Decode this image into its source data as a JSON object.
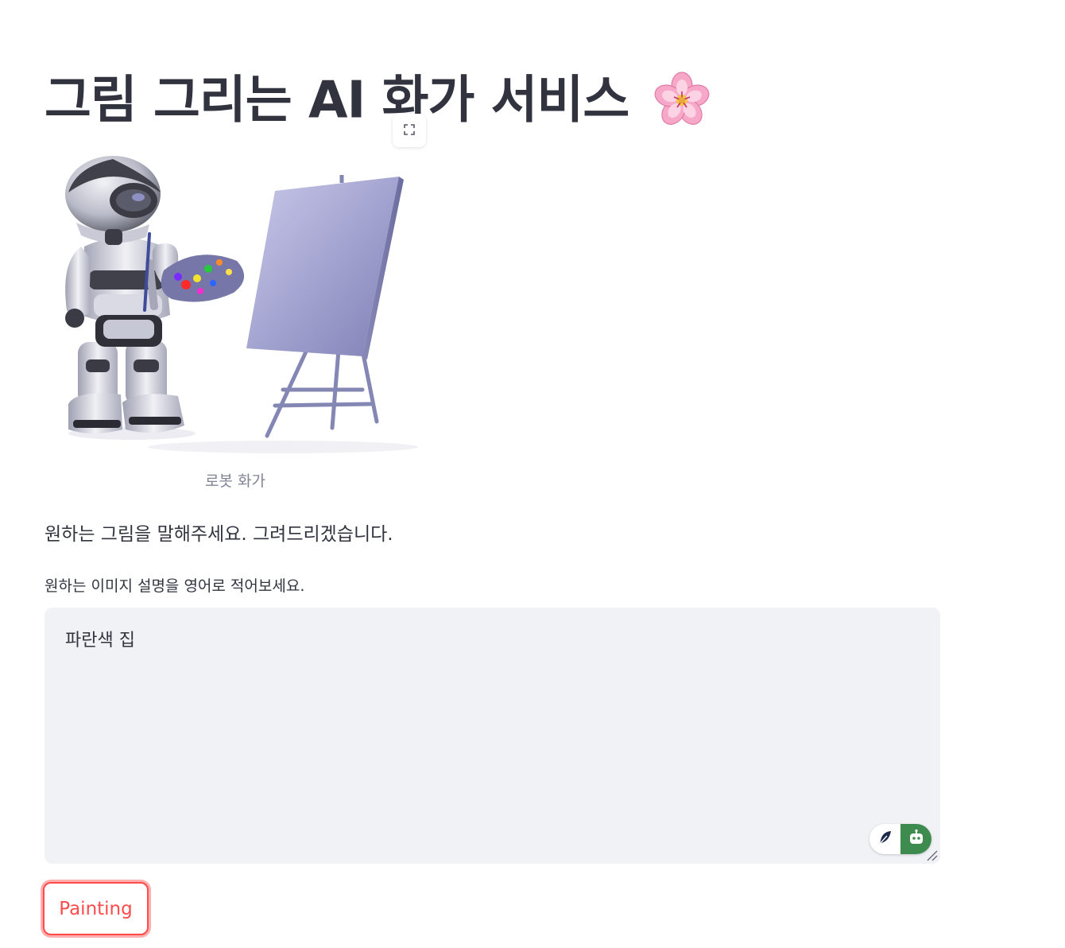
{
  "title": {
    "text": "그림 그리는 AI 화가 서비스",
    "emoji_icon": "cherry-blossom-icon"
  },
  "image": {
    "caption": "로봇 화가",
    "fullscreen_icon": "expand-icon"
  },
  "instruction": "원하는 그림을 말해주세요. 그려드리겠습니다.",
  "prompt_input": {
    "label": "원하는 이미지 설명을 영어로 적어보세요.",
    "value": "파란색 집"
  },
  "extension_widget": {
    "left_icon": "feather-pen-icon",
    "right_icon": "robot-icon",
    "right_color": "#3d8b4f"
  },
  "actions": {
    "paint_label": "Painting",
    "accent_color": "#ff4b4b"
  }
}
